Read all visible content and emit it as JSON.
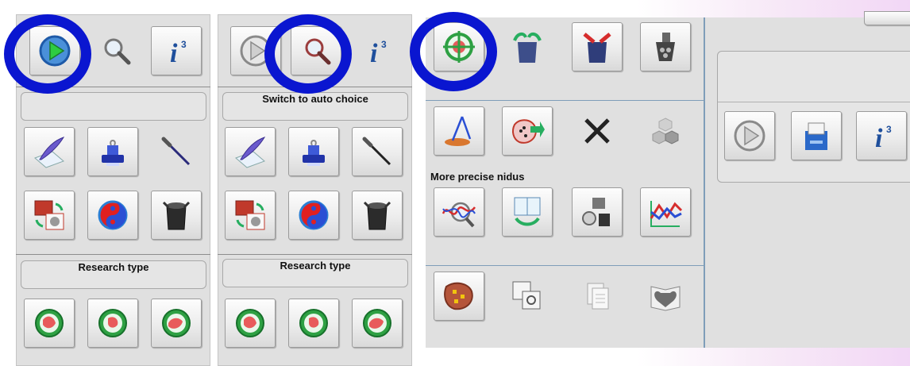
{
  "panel1": {
    "type_label": "Research type"
  },
  "panel2": {
    "auto_choice_label": "Switch to auto choice",
    "type_label": "Research type"
  },
  "panel3": {
    "nidus_label": "More precise nidus"
  },
  "highlight_color": "#0a16d0",
  "icons": {
    "play": "play-icon",
    "magnifier": "magnifier-icon",
    "info": "info-icon",
    "quill": "quill-paper-icon",
    "stamp": "stamp-icon",
    "needle": "needle-icon",
    "swap": "swap-images-icon",
    "yinyang": "yin-yang-icon",
    "bucket": "bucket-icon",
    "target": "target-icon"
  }
}
